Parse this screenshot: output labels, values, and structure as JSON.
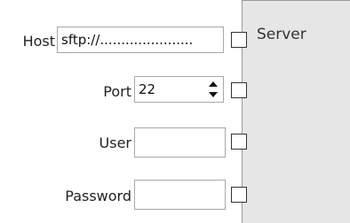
{
  "server_panel": {
    "title": "Server"
  },
  "form": {
    "host": {
      "label": "Host",
      "value": "sftp://......................"
    },
    "port": {
      "label": "Port",
      "value": "22"
    },
    "user": {
      "label": "User",
      "value": ""
    },
    "password": {
      "label": "Password",
      "value": ""
    }
  },
  "colors": {
    "panel_background": "#e6e6e6",
    "field_border": "#a8a8a8"
  }
}
